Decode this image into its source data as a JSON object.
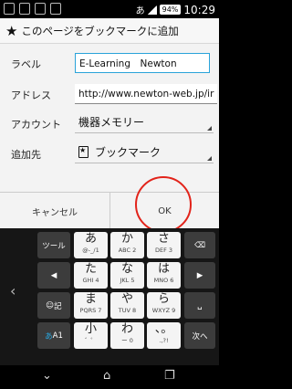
{
  "status_bar": {
    "notification_icons": [
      "app-icon",
      "sim-icon",
      "shield-icon",
      "info-icon"
    ],
    "carrier_text": "あ",
    "battery": "94%",
    "time": "10:29"
  },
  "dialog": {
    "title": "このページをブックマークに追加",
    "label_label": "ラベル",
    "label_value": "E-Learning　Newton",
    "address_label": "アドレス",
    "address_value": "http://www.newton-web.jp/ir",
    "account_label": "アカウント",
    "account_value": "機器メモリー",
    "add_to_label": "追加先",
    "add_to_value": "ブックマーク",
    "cancel": "キャンセル",
    "ok": "OK"
  },
  "keyboard": {
    "tool": "ツール",
    "kigo": "記",
    "eng": "A1",
    "next": "次へ",
    "keys": [
      {
        "main": "あ",
        "sub": "@-_/1"
      },
      {
        "main": "か",
        "sub": "ABC 2"
      },
      {
        "main": "さ",
        "sub": "DEF 3"
      },
      {
        "main": "た",
        "sub": "GHI 4"
      },
      {
        "main": "な",
        "sub": "JKL 5"
      },
      {
        "main": "は",
        "sub": "MNO 6"
      },
      {
        "main": "ま",
        "sub": "PQRS 7"
      },
      {
        "main": "や",
        "sub": "TUV 8"
      },
      {
        "main": "ら",
        "sub": "WXYZ 9"
      },
      {
        "main": "小",
        "sub": "゛゜"
      },
      {
        "main": "わ",
        "sub": "ー 0"
      },
      {
        "main": "、。",
        "sub": ".,?!"
      }
    ]
  }
}
